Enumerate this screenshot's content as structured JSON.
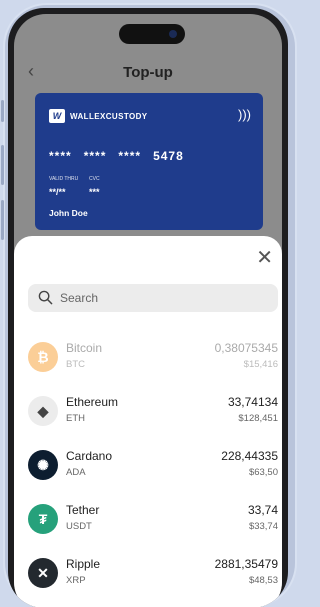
{
  "header": {
    "title": "Top-up",
    "back_icon": "chevron-left-icon"
  },
  "card": {
    "brand": "WALLEXCUSTODY",
    "logo_glyph": "W",
    "number_groups": [
      "****",
      "****",
      "****",
      "5478"
    ],
    "valid_thru_label": "VALID THRU",
    "valid_thru_value": "**/**",
    "cvc_label": "CVC",
    "cvc_value": "***",
    "holder": "John Doe",
    "color": "#1f3c8c"
  },
  "sheet": {
    "search": {
      "placeholder": "Search",
      "value": ""
    },
    "coins": [
      {
        "name": "Bitcoin",
        "symbol": "BTC",
        "amount": "0,38075345",
        "fiat": "$15,416",
        "icon": "bitcoin-icon",
        "glyph": "₿",
        "color": "#f7931a",
        "disabled": true
      },
      {
        "name": "Ethereum",
        "symbol": "ETH",
        "amount": "33,74134",
        "fiat": "$128,451",
        "icon": "ethereum-icon",
        "glyph": "◆",
        "color": "#ececec"
      },
      {
        "name": "Cardano",
        "symbol": "ADA",
        "amount": "228,44335",
        "fiat": "$63,50",
        "icon": "cardano-icon",
        "glyph": "✺",
        "color": "#0d1e30"
      },
      {
        "name": "Tether",
        "symbol": "USDT",
        "amount": "33,74",
        "fiat": "$33,74",
        "icon": "tether-icon",
        "glyph": "₮",
        "color": "#26a17b"
      },
      {
        "name": "Ripple",
        "symbol": "XRP",
        "amount": "2881,35479",
        "fiat": "$48,53",
        "icon": "ripple-icon",
        "glyph": "✕",
        "color": "#23292f"
      }
    ]
  }
}
